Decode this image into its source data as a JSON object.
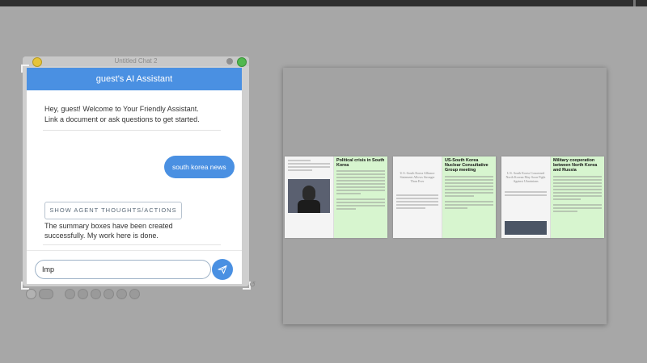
{
  "window": {
    "title": "Untitled Chat 2"
  },
  "chat": {
    "header_title": "guest's AI Assistant",
    "welcome_line1": "Hey, guest! Welcome to Your Friendly Assistant.",
    "welcome_line2": "Link a document or ask questions to get started.",
    "user_message": "south korea news",
    "thoughts_button": "SHOW AGENT THOUGHTS/ACTIONS",
    "reply_line1": "The summary boxes have been created",
    "reply_line2": "successfully. My work here is done.",
    "input_value": "Imp",
    "send_icon": "send-icon"
  },
  "canvas": {
    "cards": [
      {
        "title": "Political crisis in South Korea",
        "image_caption": ""
      },
      {
        "title": "US-South Korea Nuclear Consultative Group meeting",
        "image_caption": "U.S.-South Korea Alliance Statement Allows Stronger Than Ever"
      },
      {
        "title": "Military cooperation between North Korea and Russia",
        "image_caption": "U.S. South Korea Concerned North Korean May Soon Fight Against Ukrainians"
      }
    ]
  },
  "colors": {
    "accent": "#4a90e2",
    "card_summary_bg": "#d7f5cf",
    "background": "#a7a7a7"
  }
}
